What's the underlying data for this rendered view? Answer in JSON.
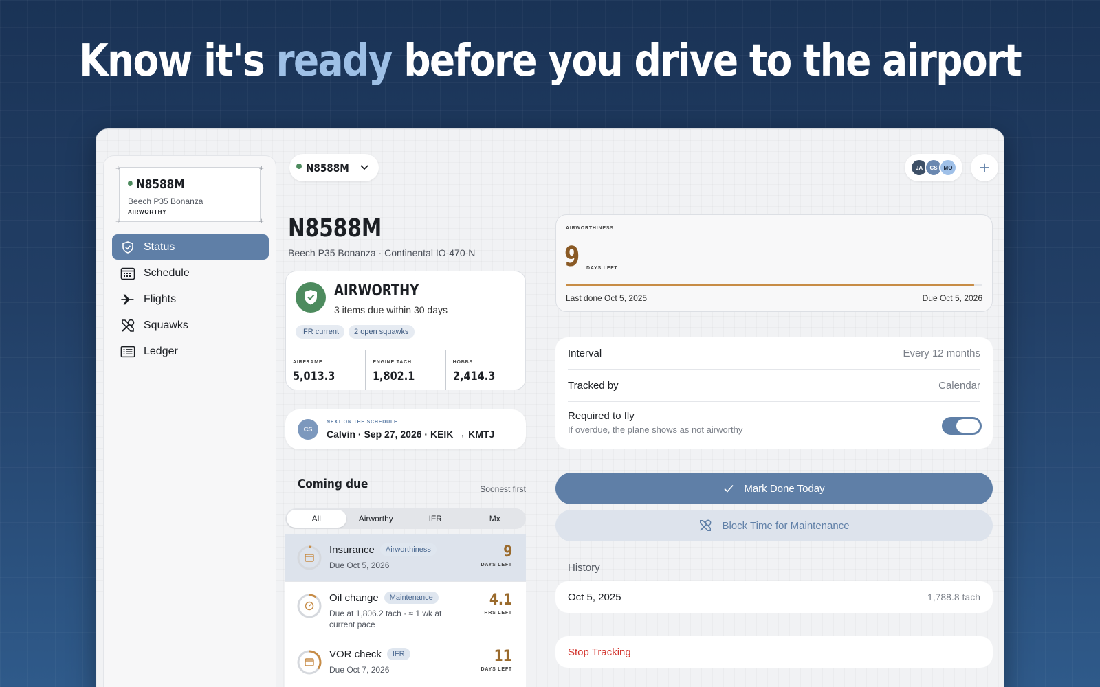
{
  "headline": {
    "before": "Know it's ",
    "accent": "ready",
    "after": " before you drive to the airport"
  },
  "colors": {
    "accent": "#5f7fa7",
    "airworthy_green": "#4d8b5e",
    "due_amber": "#9a6a2c",
    "danger": "#d2312a"
  },
  "sidebar": {
    "aircraft": {
      "tail": "N8588M",
      "model": "Beech P35 Bonanza",
      "status": "AIRWORTHY"
    },
    "items": [
      {
        "label": "Status",
        "icon": "shield-check-icon"
      },
      {
        "label": "Schedule",
        "icon": "calendar-icon"
      },
      {
        "label": "Flights",
        "icon": "airplane-icon"
      },
      {
        "label": "Squawks",
        "icon": "tools-icon"
      },
      {
        "label": "Ledger",
        "icon": "ledger-icon"
      }
    ]
  },
  "topbar": {
    "plane": "N8588M",
    "members": [
      {
        "initials": "JA",
        "color": "#3d4f66"
      },
      {
        "initials": "CS",
        "color": "#6a88b0"
      },
      {
        "initials": "MO",
        "color": "#9fc0e8"
      }
    ],
    "add": "+"
  },
  "aircraft": {
    "tail": "N8588M",
    "subtitle": "Beech P35 Bonanza · Continental IO-470-N",
    "status_title": "AIRWORTHY",
    "status_sub": "3 items due within 30 days",
    "chips": [
      "IFR current",
      "2 open squawks"
    ],
    "meters": [
      {
        "label": "AIRFRAME",
        "value": "5,013.3"
      },
      {
        "label": "ENGINE TACH",
        "value": "1,802.1"
      },
      {
        "label": "HOBBS",
        "value": "2,414.3"
      }
    ]
  },
  "next": {
    "initials": "CS",
    "label": "NEXT ON THE SCHEDULE",
    "value": "Calvin · Sep 27, 2026 · KEIK → KMTJ"
  },
  "coming_due": {
    "title": "Coming due",
    "sort": "Soonest first",
    "filters": [
      "All",
      "Airworthy",
      "IFR",
      "Mx"
    ],
    "items": [
      {
        "name": "Insurance",
        "tag": "Airworthiness",
        "sub": "Due Oct 5, 2026",
        "value": "9",
        "unit": "DAYS LEFT",
        "icon": "calendar-icon",
        "progress": 0.03
      },
      {
        "name": "Oil change",
        "tag": "Maintenance",
        "sub": "Due at 1,806.2 tach · ≈ 1 wk at current pace",
        "value": "4.1",
        "unit": "HRS LEFT",
        "icon": "gauge-icon",
        "progress": 0.1
      },
      {
        "name": "VOR check",
        "tag": "IFR",
        "sub": "Due Oct 7, 2026",
        "value": "11",
        "unit": "DAYS LEFT",
        "icon": "calendar-icon",
        "progress": 0.35
      }
    ]
  },
  "detail": {
    "label": "AIRWORTHINESS",
    "days": "9",
    "unit": "DAYS LEFT",
    "progress": 0.98,
    "last_done": "Last done Oct 5, 2025",
    "due": "Due Oct 5, 2026",
    "interval_k": "Interval",
    "interval_v": "Every 12 months",
    "tracked_k": "Tracked by",
    "tracked_v": "Calendar",
    "required_k": "Required to fly",
    "required_s": "If overdue, the plane shows as not airworthy",
    "required_on": true,
    "mark_done": "Mark Done Today",
    "block_time": "Block Time for Maintenance",
    "history_title": "History",
    "history": [
      {
        "date": "Oct 5, 2025",
        "tach": "1,788.8 tach"
      }
    ],
    "stop": "Stop Tracking"
  }
}
